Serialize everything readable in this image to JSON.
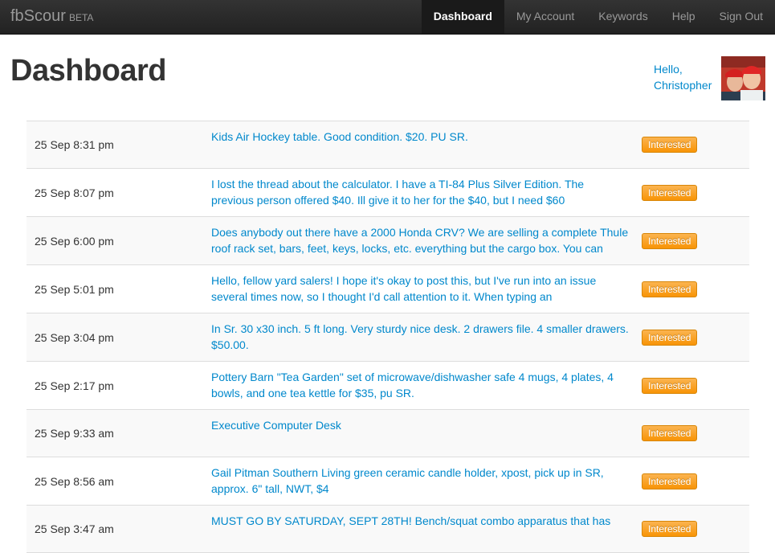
{
  "nav": {
    "brand": "fbScour",
    "brand_tag": "BETA",
    "items": [
      {
        "label": "Dashboard",
        "active": true
      },
      {
        "label": "My Account",
        "active": false
      },
      {
        "label": "Keywords",
        "active": false
      },
      {
        "label": "Help",
        "active": false
      },
      {
        "label": "Sign Out",
        "active": false
      }
    ]
  },
  "page": {
    "title": "Dashboard",
    "greeting_line1": "Hello,",
    "greeting_line2": "Christopher"
  },
  "posts": [
    {
      "time": "25 Sep 8:31 pm",
      "text": "Kids Air Hockey table. Good condition. $20. PU SR.",
      "badge": "Interested"
    },
    {
      "time": "25 Sep 8:07 pm",
      "text": "I lost the thread about the calculator. I have a TI-84 Plus Silver Edition. The previous person offered $40. Ill give it to her for the $40, but I need $60",
      "badge": "Interested"
    },
    {
      "time": "25 Sep 6:00 pm",
      "text": "Does anybody out there have a 2000 Honda CRV? We are selling a complete Thule roof rack set, bars, feet, keys, locks, etc. everything but the cargo box. You can",
      "badge": "Interested"
    },
    {
      "time": "25 Sep 5:01 pm",
      "text": "Hello, fellow yard salers! I hope it's okay to post this, but I've run into an issue several times now, so I thought I'd call attention to it. When typing an",
      "badge": "Interested"
    },
    {
      "time": "25 Sep 3:04 pm",
      "text": "In Sr. 30 x30 inch. 5 ft long. Very sturdy nice desk. 2 drawers file. 4 smaller drawers. $50.00.",
      "badge": "Interested"
    },
    {
      "time": "25 Sep 2:17 pm",
      "text": "Pottery Barn \"Tea Garden\" set of microwave/dishwasher safe 4 mugs, 4 plates, 4 bowls, and one tea kettle for $35, pu SR.",
      "badge": "Interested"
    },
    {
      "time": "25 Sep 9:33 am",
      "text": "Executive Computer Desk",
      "badge": "Interested"
    },
    {
      "time": "25 Sep 8:56 am",
      "text": "Gail Pitman Southern Living green ceramic candle holder, xpost, pick up in SR, approx. 6\" tall, NWT, $4",
      "badge": "Interested"
    },
    {
      "time": "25 Sep 3:47 am",
      "text": "MUST GO BY SATURDAY, SEPT 28TH! Bench/squat combo apparatus that has",
      "badge": "Interested"
    }
  ]
}
